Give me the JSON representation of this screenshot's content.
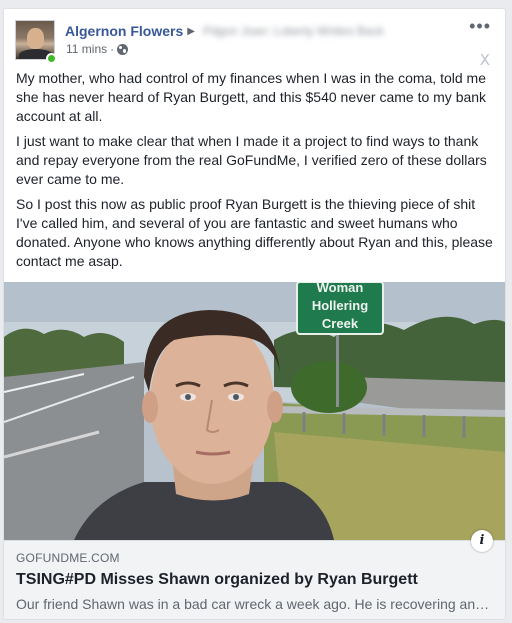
{
  "post": {
    "author": "Algernon Flowers",
    "group_name": "Pdgon Joan: Loberty Wnites Back",
    "time": "11 mins",
    "more_label": "•••",
    "close_label": "X",
    "paragraphs": [
      "My mother, who had control of my finances when I was in the coma, told me she has never heard of Ryan Burgett, and this $540 never came to my bank account at all.",
      "I just want to make clear that when I made it a project to find ways to thank and repay everyone from the real GoFundMe, I verified zero of these dollars ever came to me.",
      "So I post this now as public proof Ryan Burgett is the thieving piece of shit I've called him, and several of you are fantastic and sweet humans who donated. Anyone who knows anything differently about Ryan and this, please contact me asap."
    ]
  },
  "photo": {
    "sign_lines": [
      "Woman",
      "Hollering",
      "Creek"
    ]
  },
  "link_preview": {
    "domain": "GOFUNDME.COM",
    "title": "TSING#PD Misses Shawn organized by Ryan Burgett",
    "description": "Our friend Shawn was in a bad car wreck a week ago. He is recovering and is out of the coma now.",
    "info_label": "i"
  },
  "icons": {
    "privacy": "globe-icon",
    "options": "more-icon",
    "dismiss": "close-icon",
    "info": "info-icon"
  }
}
